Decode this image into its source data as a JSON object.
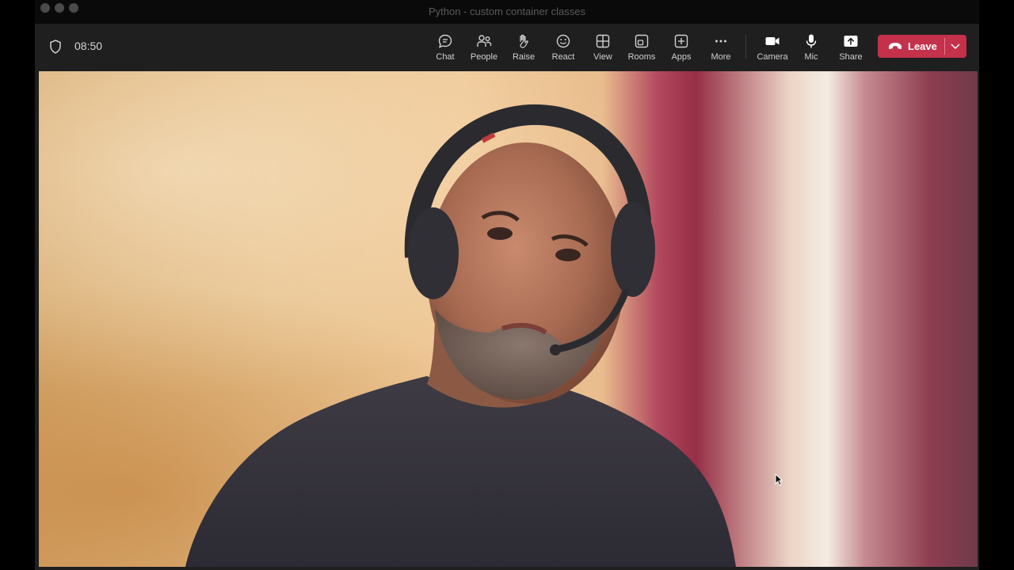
{
  "window": {
    "title": "Python - custom container classes"
  },
  "toolbar": {
    "timer": "08:50",
    "tools": [
      {
        "id": "chat",
        "label": "Chat",
        "icon": "chat-icon"
      },
      {
        "id": "people",
        "label": "People",
        "icon": "people-icon"
      },
      {
        "id": "raise",
        "label": "Raise",
        "icon": "raise-hand-icon"
      },
      {
        "id": "react",
        "label": "React",
        "icon": "smiley-icon"
      },
      {
        "id": "view",
        "label": "View",
        "icon": "grid-view-icon"
      },
      {
        "id": "rooms",
        "label": "Rooms",
        "icon": "rooms-icon"
      },
      {
        "id": "apps",
        "label": "Apps",
        "icon": "plus-square-icon"
      },
      {
        "id": "more",
        "label": "More",
        "icon": "ellipsis-icon"
      },
      {
        "id": "camera",
        "label": "Camera",
        "icon": "camera-icon"
      },
      {
        "id": "mic",
        "label": "Mic",
        "icon": "microphone-icon"
      },
      {
        "id": "share",
        "label": "Share",
        "icon": "share-tray-icon"
      }
    ],
    "leave_label": "Leave",
    "leave_color": "#c4314b"
  }
}
